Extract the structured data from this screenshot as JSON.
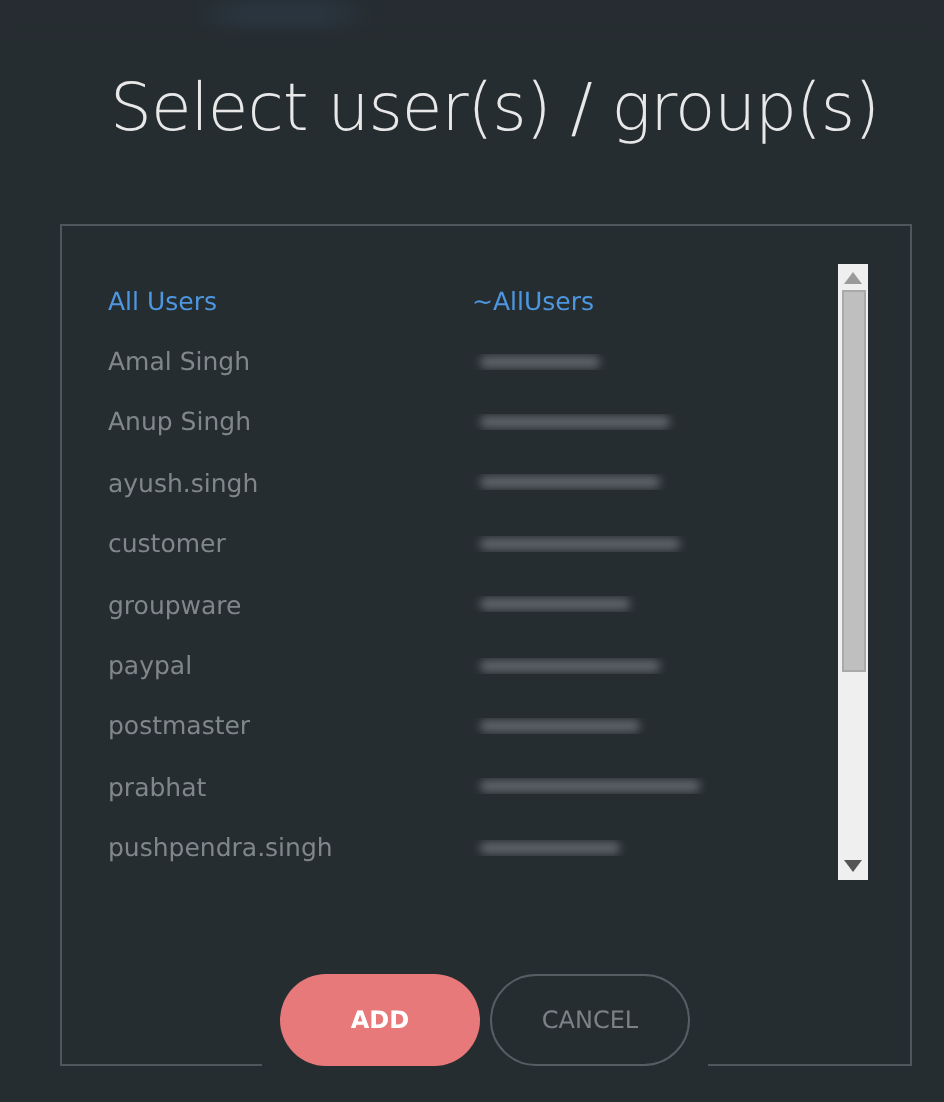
{
  "title": "Select user(s) / group(s)",
  "rows": [
    {
      "name": "All Users",
      "email": "~AllUsers",
      "selected": true
    },
    {
      "name": "Amal Singh",
      "selected": false
    },
    {
      "name": "Anup Singh",
      "selected": false
    },
    {
      "name": "ayush.singh",
      "selected": false
    },
    {
      "name": "customer",
      "selected": false
    },
    {
      "name": "groupware",
      "selected": false
    },
    {
      "name": "paypal",
      "selected": false
    },
    {
      "name": "postmaster",
      "selected": false
    },
    {
      "name": "prabhat",
      "selected": false
    },
    {
      "name": "pushpendra.singh",
      "selected": false
    }
  ],
  "buttons": [
    {
      "label": "ADD",
      "kind": "primary"
    },
    {
      "label": "CANCEL",
      "kind": "secondary"
    }
  ]
}
